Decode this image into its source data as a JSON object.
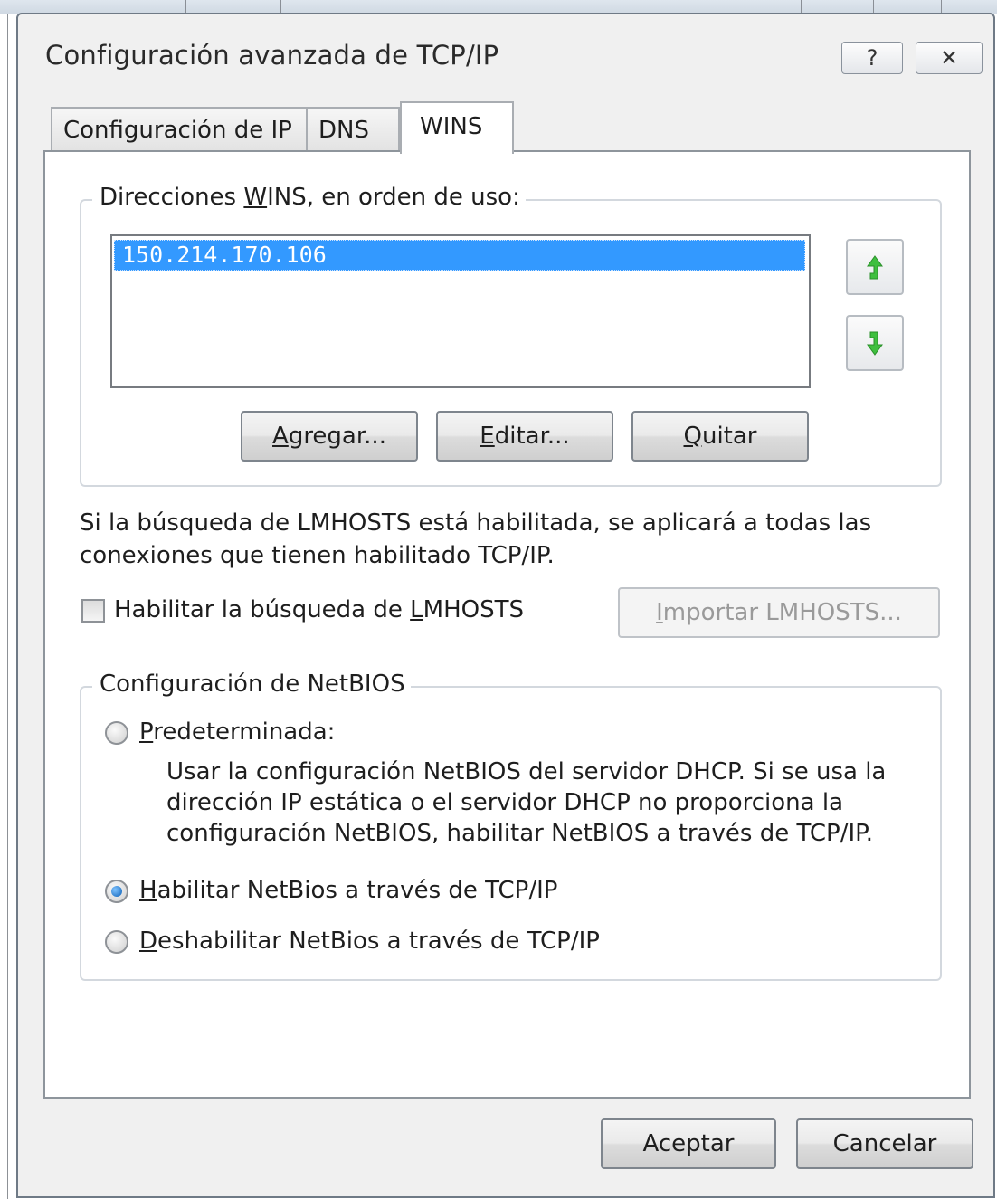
{
  "dialog": {
    "title": "Configuración avanzada de TCP/IP",
    "help_glyph": "?",
    "close_glyph": "✕"
  },
  "tabs": [
    {
      "label": "Configuración de IP",
      "active": false
    },
    {
      "label": "DNS",
      "active": false
    },
    {
      "label": "WINS",
      "active": true
    }
  ],
  "wins": {
    "group_label_pre": "Direcciones ",
    "group_label_key": "W",
    "group_label_post": "INS, en orden de uso:",
    "addresses": [
      "150.214.170.106"
    ],
    "selected_index": 0,
    "move_up_icon": "arrow-up-icon",
    "move_down_icon": "arrow-down-icon",
    "add_key": "A",
    "add_rest": "gregar...",
    "edit_key": "E",
    "edit_rest": "ditar...",
    "remove_key": "Q",
    "remove_rest": "uitar"
  },
  "lmhosts": {
    "info_line1": "Si la búsqueda de LMHOSTS está habilitada, se aplicará a todas las",
    "info_line2": "conexiones que tienen habilitado TCP/IP.",
    "enable_pre": "Habilitar la búsqueda de ",
    "enable_key": "L",
    "enable_post": "MHOSTS",
    "enabled": false,
    "import_key": "I",
    "import_rest": "mportar LMHOSTS...",
    "import_enabled": false
  },
  "netbios": {
    "group_label": "Configuración de NetBIOS",
    "default_key": "P",
    "default_rest": "redeterminada:",
    "default_desc_line1": "Usar la configuración NetBIOS del servidor DHCP. Si se usa la",
    "default_desc_line2": "dirección IP estática o el servidor DHCP no proporciona la",
    "default_desc_line3": "configuración NetBIOS, habilitar NetBIOS a través de TCP/IP.",
    "enable_key": "H",
    "enable_rest": "abilitar NetBios a través de TCP/IP",
    "disable_key": "D",
    "disable_rest": "eshabilitar NetBios a través de TCP/IP",
    "selected": "enable"
  },
  "footer": {
    "ok_label": "Aceptar",
    "cancel_label": "Cancelar"
  },
  "colors": {
    "selection": "#3399ff",
    "arrow_green": "#3fbf3f",
    "window_frame": "#6f7a86"
  }
}
